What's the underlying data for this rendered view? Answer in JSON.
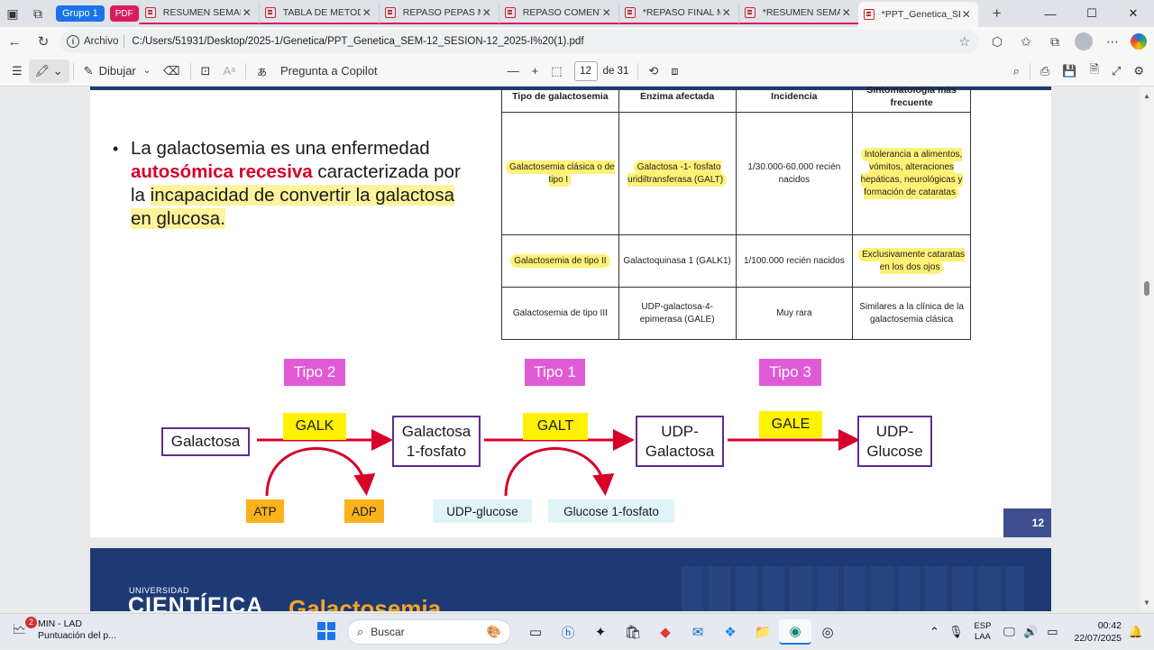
{
  "tabs": {
    "group_label": "Grupo 1",
    "pdf_chip": "PDF",
    "items": [
      {
        "label": "RESUMEN SEMANA"
      },
      {
        "label": "TABLA DE METODOS"
      },
      {
        "label": "REPASO PEPAS MT"
      },
      {
        "label": "REPASO COMENTA"
      },
      {
        "label": "*REPASO FINAL M"
      },
      {
        "label": "*RESUMEN SEMAN"
      },
      {
        "label": "*PPT_Genetica_SEM"
      }
    ]
  },
  "address": {
    "scheme": "Archivo",
    "url": "C:/Users/51931/Desktop/2025-1/Genetica/PPT_Genetica_SEM-12_SESION-12_2025-I%20(1).pdf"
  },
  "pdf_toolbar": {
    "draw": "Dibujar",
    "copilot": "Pregunta a Copilot",
    "page": "12",
    "of_pages": "de 31"
  },
  "slide": {
    "bullet_pre": "La galactosemia es una enfermedad",
    "bullet_red": "autosómica recesiva",
    "bullet_mid": " caracterizada por la ",
    "bullet_hl": "incapacidad de convertir la galactosa en glucosa.",
    "table": {
      "headers": [
        "Tipo de galactosemia",
        "Enzima afectada",
        "Incidencia",
        "Sintomatología más frecuente"
      ],
      "rows": [
        [
          "Galactosemia clásica o de tipo I",
          "Galactosa -1- fosfato uridiltransferasa (GALT)",
          "1/30.000-60.000 recién nacidos",
          "Intolerancia a alimentos, vómitos, alteraciones hepáticas, neurológicas y formación de cataratas"
        ],
        [
          "Galactosemia de tipo II",
          "Galactoquinasa 1 (GALK1)",
          "1/100.000 recién nacidos",
          "Exclusivamente cataratas en los dos ojos"
        ],
        [
          "Galactosemia de tipo III",
          "UDP-galactosa-4-epimerasa (GALE)",
          "Muy rara",
          "Similares a la clínica de la galactosemia clásica"
        ]
      ]
    },
    "pathway": {
      "types": [
        "Tipo 2",
        "Tipo 1",
        "Tipo 3"
      ],
      "metabolites": [
        "Galactosa",
        "Galactosa 1-fosfato",
        "UDP-Galactosa",
        "UDP-Glucose"
      ],
      "enzymes": [
        "GALK",
        "GALT",
        "GALE"
      ],
      "cofactors": [
        "ATP",
        "ADP",
        "UDP-glucose",
        "Glucose 1-fosfato"
      ]
    },
    "page_number": "12"
  },
  "next_slide": {
    "university_small": "UNIVERSIDAD",
    "university_big": "CIENTÍFICA",
    "title": "Galactosemia"
  },
  "taskbar": {
    "widget_title": "MIN - LAD",
    "widget_sub": "Puntuación del p...",
    "widget_badge": "2",
    "search": "Buscar",
    "lang1": "ESP",
    "lang2": "LAA",
    "time": "00:42",
    "date": "22/07/2025"
  },
  "colors": {
    "accent_blue": "#1e3a74",
    "type_pill": "#e05ad6",
    "enzyme_yellow": "#fff200",
    "arrow_red": "#d6002a",
    "metabolite_border": "#5c2d91"
  }
}
